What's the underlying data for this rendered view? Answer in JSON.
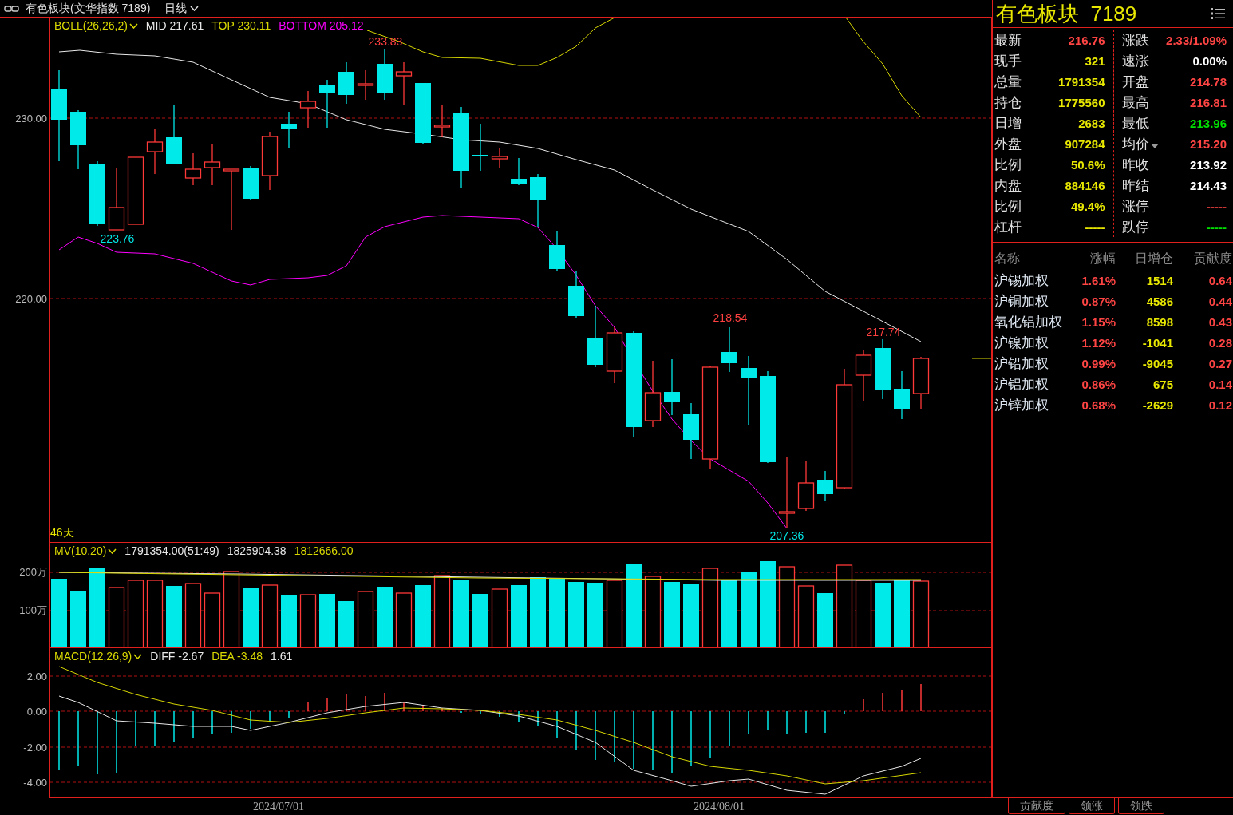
{
  "header": {
    "title": "有色板块(文华指数 7189)",
    "period": "日线"
  },
  "main_chart": {
    "indicator": "BOLL(26,26,2)",
    "mid": "MID 217.61",
    "top": "TOP 230.11",
    "bottom": "BOTTOM 205.12",
    "y_labels": [
      "230.00",
      "220.00"
    ],
    "days": "46天",
    "price_marks": [
      {
        "text": "233.83",
        "kind": "high"
      },
      {
        "text": "223.76",
        "kind": "low"
      },
      {
        "text": "218.54",
        "kind": "high"
      },
      {
        "text": "217.74",
        "kind": "high"
      },
      {
        "text": "207.36",
        "kind": "low"
      }
    ]
  },
  "volume_chart": {
    "indicator": "MV(10,20)",
    "volume": "1791354.00(51:49)",
    "ma1": "1825904.38",
    "ma2": "1812666.00",
    "y_labels": [
      "200万",
      "100万"
    ]
  },
  "macd_chart": {
    "indicator": "MACD(12,26,9)",
    "diff": "DIFF -2.67",
    "dea": "DEA -3.48",
    "macd": "1.61",
    "y_labels": [
      "2.00",
      "0.00",
      "-2.00",
      "-4.00"
    ]
  },
  "x_labels": [
    "2024/07/01",
    "2024/08/01"
  ],
  "quote": {
    "name": "有色板块",
    "code": "7189",
    "left": [
      {
        "label": "最新",
        "value": "216.76",
        "color": "#ff4444"
      },
      {
        "label": "现手",
        "value": "321",
        "color": "#e8e800"
      },
      {
        "label": "总量",
        "value": "1791354",
        "color": "#e8e800"
      },
      {
        "label": "持仓",
        "value": "1775560",
        "color": "#e8e800"
      },
      {
        "label": "日增",
        "value": "2683",
        "color": "#e8e800"
      },
      {
        "label": "外盘",
        "value": "907284",
        "color": "#e8e800"
      },
      {
        "label": "比例",
        "value": "50.6%",
        "color": "#e8e800"
      },
      {
        "label": "内盘",
        "value": "884146",
        "color": "#e8e800"
      },
      {
        "label": "比例",
        "value": "49.4%",
        "color": "#e8e800"
      },
      {
        "label": "杠杆",
        "value": "-----",
        "color": "#e8e800"
      }
    ],
    "right": [
      {
        "label": "涨跌",
        "value": "2.33/1.09%",
        "color": "#ff4444"
      },
      {
        "label": "速涨",
        "value": "0.00%",
        "color": "#ffffff"
      },
      {
        "label": "开盘",
        "value": "214.78",
        "color": "#ff4444"
      },
      {
        "label": "最高",
        "value": "216.81",
        "color": "#ff4444"
      },
      {
        "label": "最低",
        "value": "213.96",
        "color": "#00e000"
      },
      {
        "label": "均价",
        "value": "215.20",
        "color": "#ff4444",
        "dropdown": true
      },
      {
        "label": "昨收",
        "value": "213.92",
        "color": "#ffffff"
      },
      {
        "label": "昨结",
        "value": "214.43",
        "color": "#ffffff"
      },
      {
        "label": "涨停",
        "value": "-----",
        "color": "#ff4444"
      },
      {
        "label": "跌停",
        "value": "-----",
        "color": "#00e000"
      }
    ]
  },
  "components": {
    "columns": [
      "名称",
      "涨幅",
      "日增仓",
      "贡献度"
    ],
    "rows": [
      {
        "name": "沪锡加权",
        "change": "1.61%",
        "oi_change": "1514",
        "contribution": "0.64"
      },
      {
        "name": "沪铜加权",
        "change": "0.87%",
        "oi_change": "4586",
        "contribution": "0.44"
      },
      {
        "name": "氧化铝加权",
        "change": "1.15%",
        "oi_change": "8598",
        "contribution": "0.43"
      },
      {
        "name": "沪镍加权",
        "change": "1.12%",
        "oi_change": "-1041",
        "contribution": "0.28"
      },
      {
        "name": "沪铅加权",
        "change": "0.99%",
        "oi_change": "-9045",
        "contribution": "0.27"
      },
      {
        "name": "沪铝加权",
        "change": "0.86%",
        "oi_change": "675",
        "contribution": "0.14"
      },
      {
        "name": "沪锌加权",
        "change": "0.68%",
        "oi_change": "-2629",
        "contribution": "0.12"
      }
    ]
  },
  "tabs": [
    "贡献度",
    "领涨",
    "领跌"
  ]
}
